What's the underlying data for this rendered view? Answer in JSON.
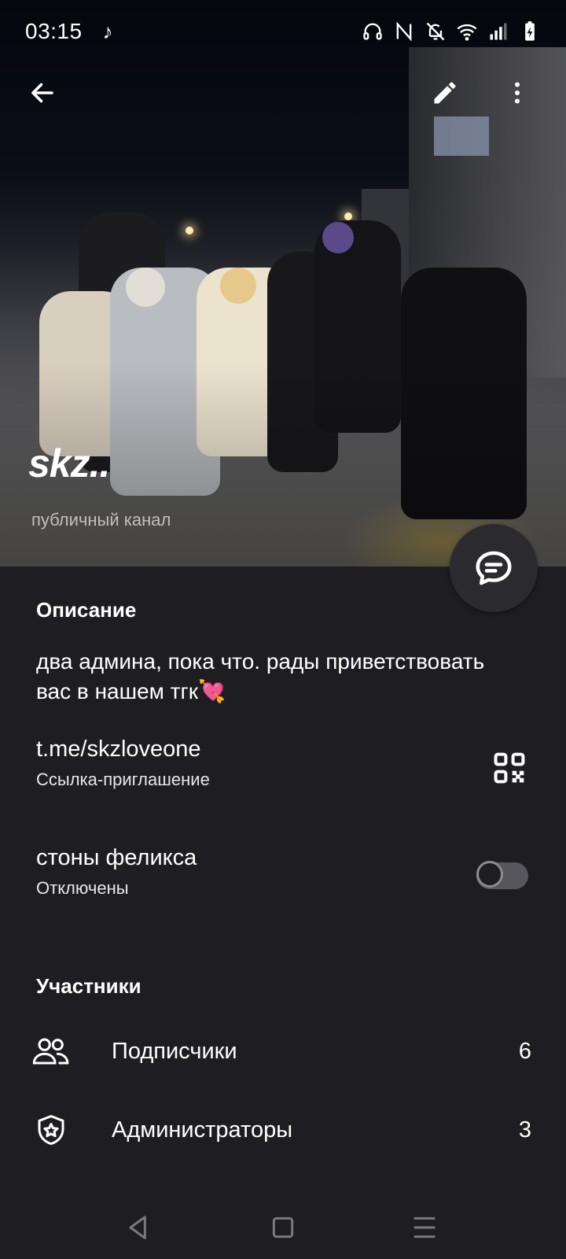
{
  "status_bar": {
    "time": "03:15",
    "icons": [
      "music-note-icon",
      "headphones-icon",
      "nfc-icon",
      "bell-off-icon",
      "wifi-icon",
      "signal-icon",
      "battery-charging-icon"
    ]
  },
  "header": {
    "back_icon": "arrow-left-icon",
    "edit_icon": "pencil-icon",
    "more_icon": "more-vertical-icon",
    "channel_name": "skz..",
    "channel_type": "публичный канал"
  },
  "description": {
    "title": "Описание",
    "text": "два админа, пока что. рады приветствовать вас в нашем тгк💘"
  },
  "invite_link": {
    "url": "t.me/skzloveone",
    "caption": "Ссылка-приглашение",
    "icon": "qr-code-icon"
  },
  "notifications": {
    "title": "стоны феликса",
    "status": "Отключены",
    "enabled": false
  },
  "members": {
    "title": "Участники",
    "items": [
      {
        "label": "Подписчики",
        "count": "6",
        "icon": "users-icon"
      },
      {
        "label": "Администраторы",
        "count": "3",
        "icon": "admin-shield-icon"
      }
    ]
  },
  "navigation": {
    "icons": [
      "back-triangle-icon",
      "home-square-icon",
      "menu-lines-icon"
    ]
  },
  "colors": {
    "background": "#1e1d21",
    "text": "#ffffff",
    "toggle_track": "#57565c"
  }
}
